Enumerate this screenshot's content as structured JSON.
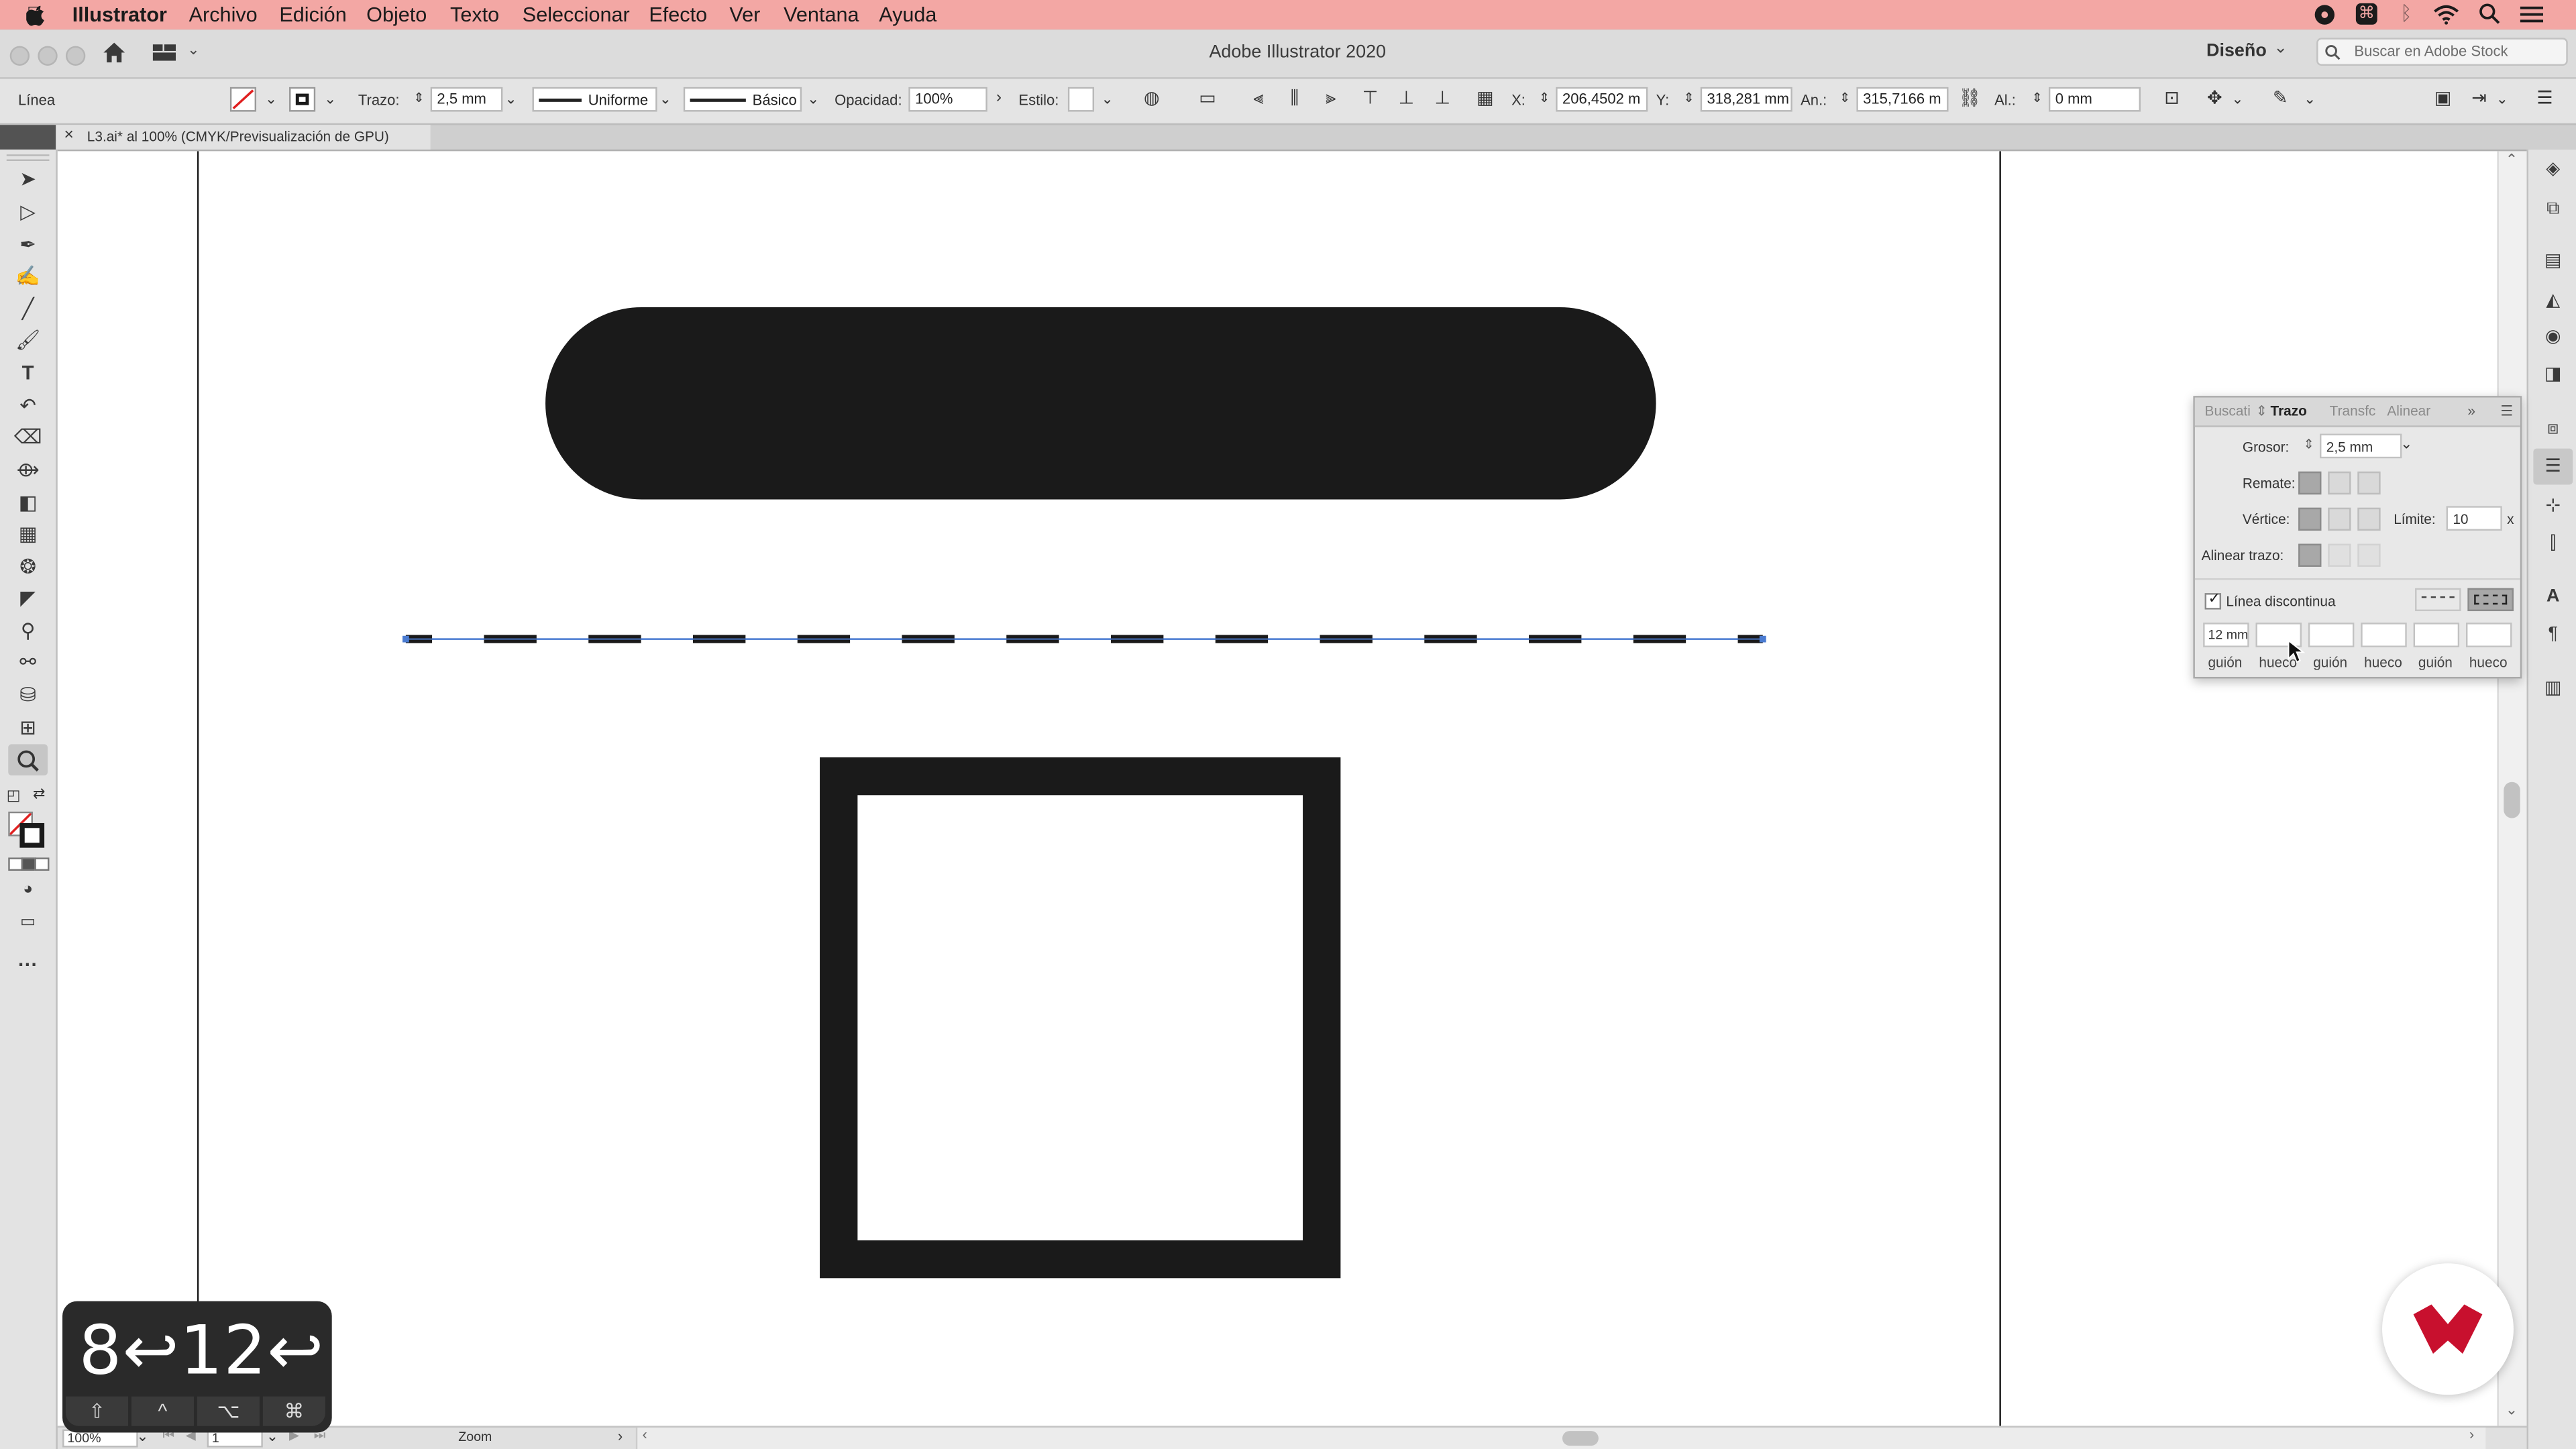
{
  "menubar": {
    "apple": "",
    "app_name": "Illustrator",
    "items": [
      "Archivo",
      "Edición",
      "Objeto",
      "Texto",
      "Seleccionar",
      "Efecto",
      "Ver",
      "Ventana",
      "Ayuda"
    ]
  },
  "titlebar": {
    "title": "Adobe Illustrator 2020",
    "workspace": "Diseño",
    "stock_search_placeholder": "Buscar en Adobe Stock"
  },
  "controlbar": {
    "selection_type": "Línea",
    "stroke_label": "Trazo:",
    "stroke_value": "2,5 mm",
    "profile": "Uniforme",
    "brush": "Básico",
    "opacity_label": "Opacidad:",
    "opacity_value": "100%",
    "style_label": "Estilo:",
    "x_label": "X:",
    "x_value": "206,4502 m",
    "y_label": "Y:",
    "y_value": "318,281 mm",
    "w_label": "An.:",
    "w_value": "315,7166 m",
    "h_label": "Al.:",
    "h_value": "0 mm"
  },
  "document": {
    "tab_label": "L3.ai* al 100% (CMYK/Previsualización de GPU)",
    "close_glyph": "×"
  },
  "stroke_panel": {
    "tabs": [
      "Buscati",
      "Trazo",
      "Transfc",
      "Alinear"
    ],
    "active_tab": "Trazo",
    "weight_label": "Grosor:",
    "weight_value": "2,5 mm",
    "cap_label": "Remate:",
    "corner_label": "Vértice:",
    "limit_label": "Límite:",
    "limit_value": "10",
    "limit_unit": "x",
    "align_label": "Alinear trazo:",
    "dashed_label": "Línea discontinua",
    "dashed_checked": true,
    "dash_values": [
      "12 mm",
      "",
      "",
      "",
      "",
      ""
    ],
    "dash_labels": [
      "guión",
      "hueco",
      "guión",
      "hueco",
      "guión",
      "hueco"
    ]
  },
  "statusbar": {
    "zoom": "100%",
    "artboard": "1",
    "tool": "Zoom"
  },
  "keycast": {
    "text": "8↩12↩",
    "modifiers": [
      "⇧",
      "^",
      "⌥",
      "⌘"
    ]
  },
  "colors": {
    "menubar_bg": "#f3a7a4",
    "shape_fill": "#1a1a1a",
    "selection_blue": "#4a7bd1",
    "logo_red": "#c8102e"
  }
}
